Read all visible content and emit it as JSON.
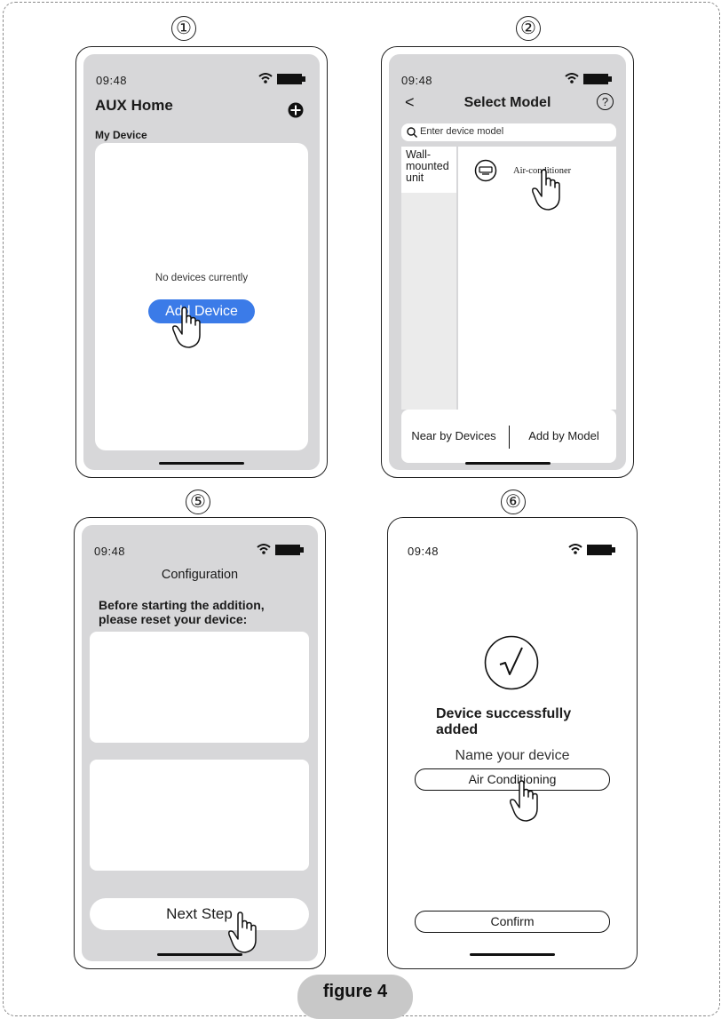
{
  "figure_label": "figure 4",
  "steps": {
    "s1": "①",
    "s2": "②",
    "s5": "⑤",
    "s6": "⑥"
  },
  "status_time": "09:48",
  "screen1": {
    "title": "AUX Home",
    "section": "My Device",
    "empty_text": "No devices currently",
    "add_button": "Add Device",
    "accent": "#3b7be8"
  },
  "screen2": {
    "back": "<",
    "title": "Select Model",
    "help": "?",
    "search_placeholder": "Enter device model",
    "category": "Wall-\nmounted\nunit",
    "item": "Air-conditioner",
    "tab_near": "Near by Devices",
    "tab_model": "Add by Model"
  },
  "screen5": {
    "title": "Configuration",
    "instruction": "Before starting the addition,\nplease reset your device:",
    "next_button": "Next Step"
  },
  "screen6": {
    "success": "Device successfully\nadded",
    "name_label": "Name your device",
    "name_value": "Air Conditioning",
    "confirm": "Confirm"
  },
  "icons": [
    "wifi-icon",
    "battery-icon",
    "plus-circle-icon",
    "help-icon",
    "search-icon",
    "aircon-icon",
    "checkmark-icon",
    "tap-hand-icon"
  ]
}
